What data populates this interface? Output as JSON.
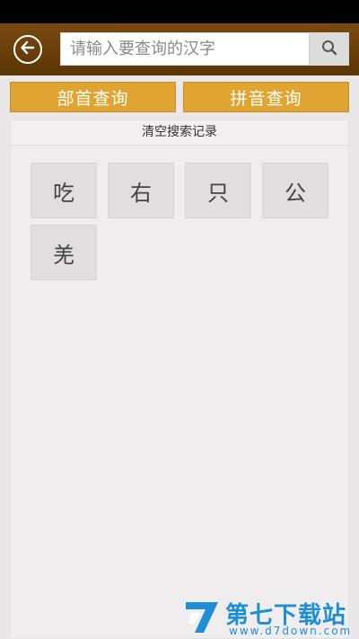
{
  "header": {
    "search": {
      "placeholder": "请输入要查询的汉字",
      "value": ""
    }
  },
  "modes": [
    {
      "label": "部首查询"
    },
    {
      "label": "拼音查询"
    }
  ],
  "history": {
    "clear_label": "清空搜索记录",
    "items": [
      "吃",
      "右",
      "只",
      "公",
      "羌"
    ]
  },
  "watermark": {
    "title": "第七下载站",
    "url": "www.d7down.com"
  },
  "colors": {
    "top_bar": "#6b400b",
    "mode_button": "#e0a433",
    "background": "#e9e7e7",
    "watermark": "#1e8fd6"
  }
}
